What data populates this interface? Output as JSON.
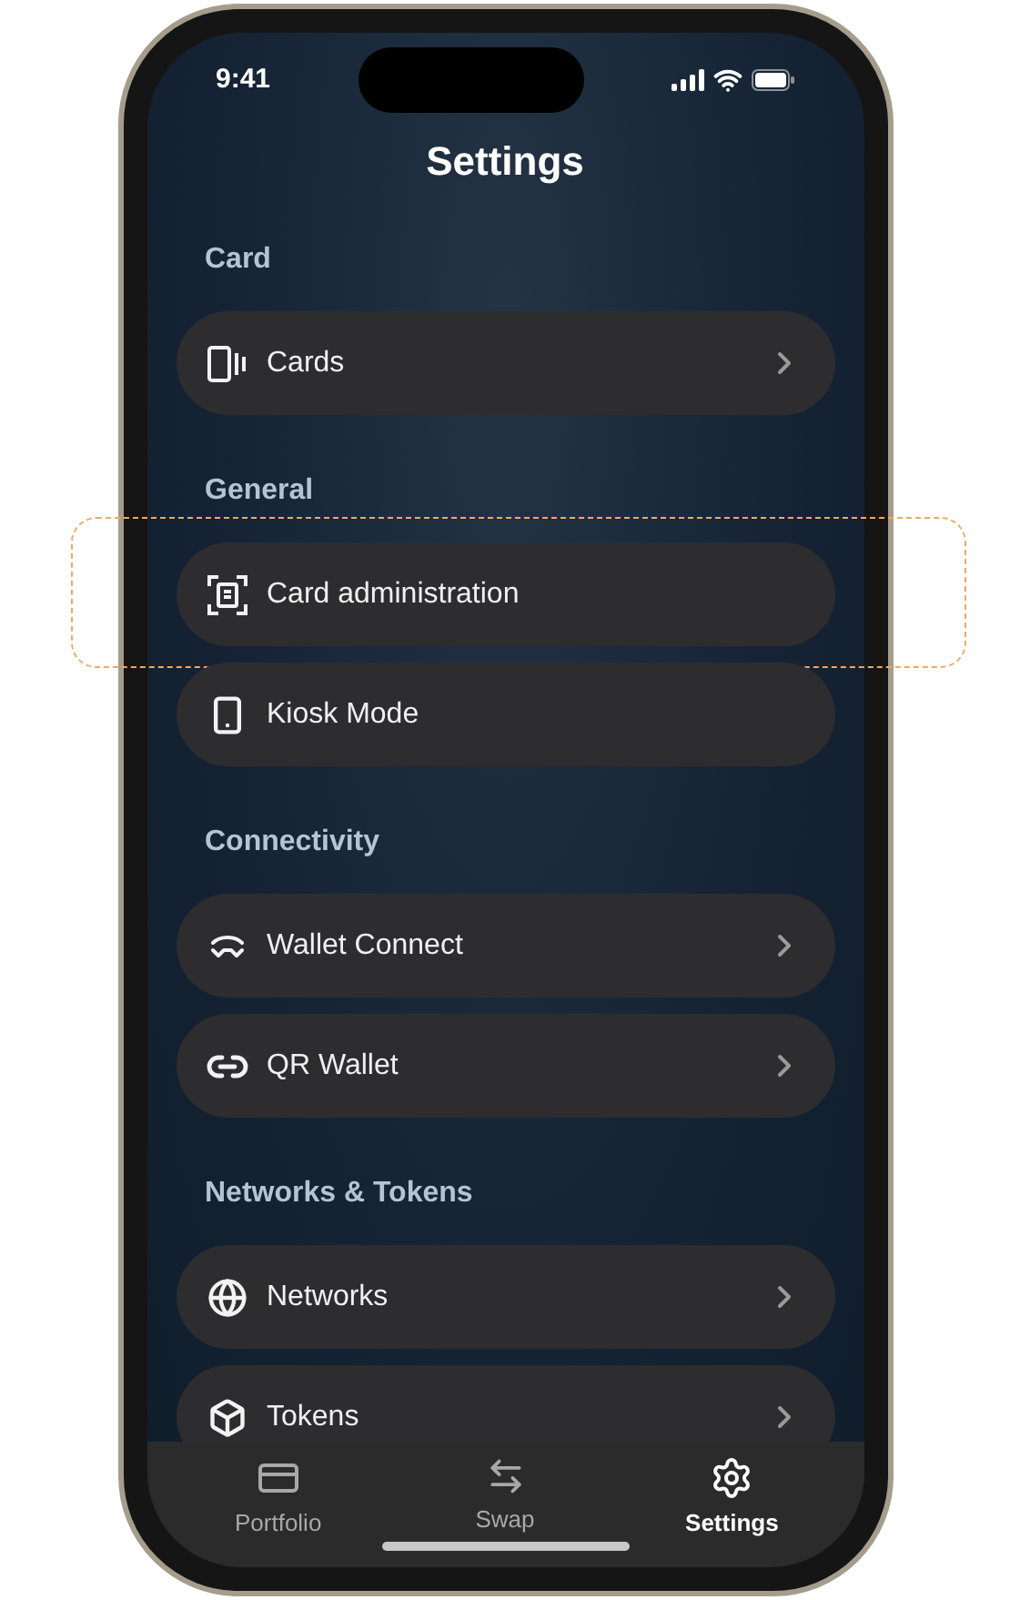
{
  "status_bar": {
    "time": "9:41"
  },
  "title": "Settings",
  "sections": [
    {
      "header": "Card",
      "items": [
        {
          "label": "Cards",
          "chevron": true,
          "highlighted": false
        }
      ]
    },
    {
      "header": "General",
      "items": [
        {
          "label": "Card administration",
          "chevron": false,
          "highlighted": true
        },
        {
          "label": "Kiosk Mode",
          "chevron": false,
          "highlighted": false
        }
      ]
    },
    {
      "header": "Connectivity",
      "items": [
        {
          "label": "Wallet Connect",
          "chevron": true,
          "highlighted": false
        },
        {
          "label": "QR Wallet",
          "chevron": true,
          "highlighted": false
        }
      ]
    },
    {
      "header": "Networks & Tokens",
      "items": [
        {
          "label": "Networks",
          "chevron": true,
          "highlighted": false
        },
        {
          "label": "Tokens",
          "chevron": true,
          "highlighted": false
        }
      ]
    }
  ],
  "tab_bar": [
    {
      "label": "Portfolio",
      "selected": false
    },
    {
      "label": "Swap",
      "selected": false
    },
    {
      "label": "Settings",
      "selected": true
    }
  ]
}
